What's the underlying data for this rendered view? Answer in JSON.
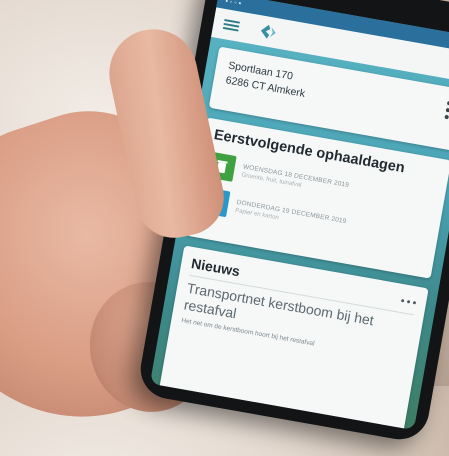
{
  "app": {
    "logo_text_line1": "",
    "logo_text_line2": ""
  },
  "address_card": {
    "line1": "Sportlaan 170",
    "line2": "6286 CT Almkerk"
  },
  "pickup_card": {
    "title": "Eerstvolgende ophaaldagen",
    "items": [
      {
        "date": "WOENSDAG 18 DECEMBER 2019",
        "type": "Groente, fruit, tuinafval",
        "icon": "green-bin-icon",
        "color": "#3fa142"
      },
      {
        "date": "DONDERDAG 19 DECEMBER 2019",
        "type": "Papier en karton",
        "icon": "blue-bin-icon",
        "color": "#2a98c9"
      }
    ]
  },
  "news_card": {
    "title": "Nieuws",
    "headline": "Transportnet kerstboom bij het restafval",
    "snippet": "Het net om de kerstboom hoort bij het restafval"
  },
  "colors": {
    "status_bar": "#2b6f9c",
    "accent": "#2f7d88",
    "screen_background": "#4aa3b4"
  }
}
